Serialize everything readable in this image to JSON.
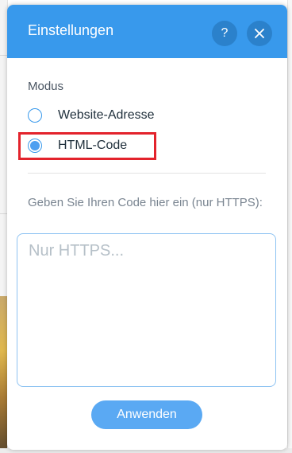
{
  "panel": {
    "title": "Einstellungen",
    "help_label": "?",
    "close_icon": "close-icon"
  },
  "mode": {
    "label": "Modus",
    "options": [
      {
        "label": "Website-Adresse",
        "selected": false
      },
      {
        "label": "HTML-Code",
        "selected": true
      }
    ]
  },
  "code": {
    "instruction": "Geben Sie Ihren Code hier ein (nur HTTPS):",
    "placeholder": "Nur HTTPS...",
    "value": ""
  },
  "actions": {
    "apply_label": "Anwenden"
  },
  "colors": {
    "header": "#3899ec",
    "accent": "#4e9ff0",
    "highlight": "#e3232c"
  }
}
